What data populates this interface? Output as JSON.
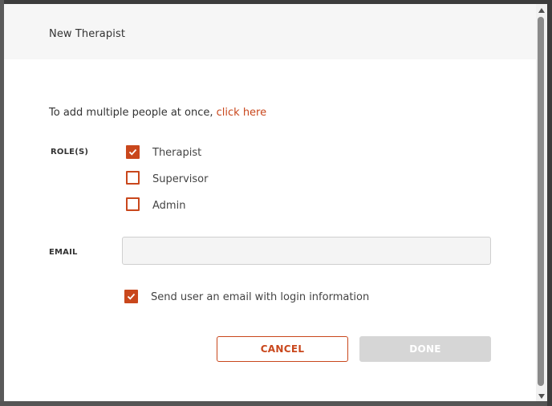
{
  "dialog": {
    "title": "New Therapist",
    "intro_text": "To add multiple people at once, ",
    "intro_link": "click here"
  },
  "roles": {
    "label": "ROLE(S)",
    "options": [
      {
        "label": "Therapist",
        "checked": true
      },
      {
        "label": "Supervisor",
        "checked": false
      },
      {
        "label": "Admin",
        "checked": false
      }
    ]
  },
  "email": {
    "label": "EMAIL",
    "value": "",
    "placeholder": ""
  },
  "send_email": {
    "label": "Send user an email with login information",
    "checked": true
  },
  "buttons": {
    "cancel": "CANCEL",
    "done": "DONE"
  },
  "colors": {
    "accent": "#c9471c",
    "disabled": "#d6d6d6",
    "header_bg": "#f6f6f6"
  },
  "icons": {
    "checkmark": "check-icon",
    "scroll_up": "scroll-up-arrow-icon",
    "scroll_down": "scroll-down-arrow-icon"
  }
}
